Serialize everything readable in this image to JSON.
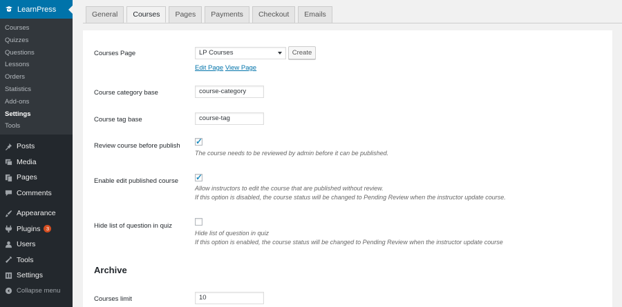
{
  "sidebar": {
    "brand": "LearnPress",
    "submenu": [
      "Courses",
      "Quizzes",
      "Questions",
      "Lessons",
      "Orders",
      "Statistics",
      "Add-ons",
      "Settings",
      "Tools"
    ],
    "current_submenu": "Settings",
    "menu": [
      {
        "label": "Posts",
        "icon": "pin-icon"
      },
      {
        "label": "Media",
        "icon": "media-icon"
      },
      {
        "label": "Pages",
        "icon": "pages-icon"
      },
      {
        "label": "Comments",
        "icon": "comments-icon"
      },
      {
        "label": "Appearance",
        "icon": "brush-icon"
      },
      {
        "label": "Plugins",
        "icon": "plugin-icon",
        "badge": "3"
      },
      {
        "label": "Users",
        "icon": "users-icon"
      },
      {
        "label": "Tools",
        "icon": "tools-icon"
      },
      {
        "label": "Settings",
        "icon": "settings-icon"
      }
    ],
    "collapse": "Collapse menu"
  },
  "tabs": [
    "General",
    "Courses",
    "Pages",
    "Payments",
    "Checkout",
    "Emails"
  ],
  "active_tab": "Courses",
  "form": {
    "courses_page": {
      "label": "Courses Page",
      "value": "LP Courses",
      "create": "Create",
      "edit_link": "Edit Page",
      "view_link": "View Page"
    },
    "category_base": {
      "label": "Course category base",
      "value": "course-category"
    },
    "tag_base": {
      "label": "Course tag base",
      "value": "course-tag"
    },
    "review": {
      "label": "Review course before publish",
      "checked": true,
      "desc": "The course needs to be reviewed by admin before it can be published."
    },
    "edit_published": {
      "label": "Enable edit published course",
      "checked": true,
      "desc1": "Allow instructors to edit the course that are published without review.",
      "desc2": "If this option is disabled, the course status will be changed to Pending Review when the instructor update course."
    },
    "hide_questions": {
      "label": "Hide list of question in quiz",
      "checked": false,
      "desc1": "Hide list of question in quiz",
      "desc2": "If this option is enabled, the course status will be changed to Pending Review when the instructor update course"
    },
    "archive_title": "Archive",
    "courses_limit": {
      "label": "Courses limit",
      "value": "10"
    }
  },
  "colors": {
    "accent": "#0073aa",
    "sidebar_bg": "#23282d",
    "badge": "#d54e21"
  }
}
